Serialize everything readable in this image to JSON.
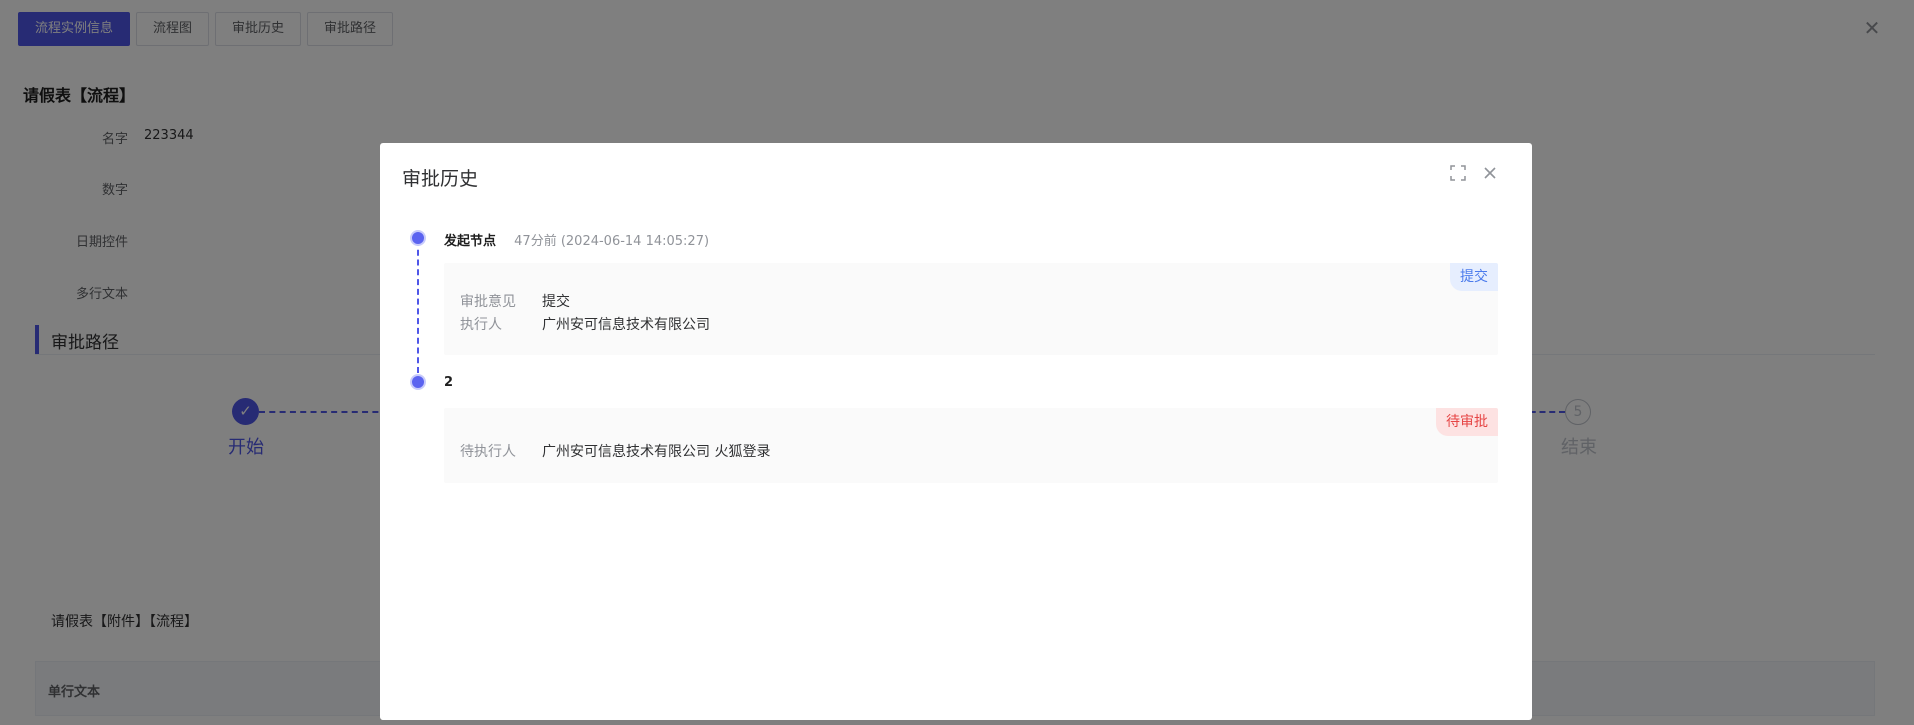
{
  "tabs": [
    {
      "label": "流程实例信息",
      "active": true
    },
    {
      "label": "流程图",
      "active": false
    },
    {
      "label": "审批历史",
      "active": false
    },
    {
      "label": "审批路径",
      "active": false
    }
  ],
  "form": {
    "title": "请假表【流程】",
    "fields": [
      {
        "label": "名字",
        "value": "223344"
      },
      {
        "label": "数字",
        "value": ""
      },
      {
        "label": "日期控件",
        "value": ""
      },
      {
        "label": "多行文本",
        "value": ""
      }
    ]
  },
  "approval_path": {
    "section_title": "审批路径",
    "steps": [
      {
        "label": "开始",
        "status": "done"
      },
      {
        "label": "结束",
        "status": "pending",
        "index": "5"
      }
    ]
  },
  "attachment": {
    "title": "请假表【附件】【流程】",
    "table_header": "单行文本"
  },
  "modal": {
    "title": "审批历史",
    "timeline": [
      {
        "node": "发起节点",
        "time": "47分前  (2024-06-14 14:05:27)",
        "badge": "提交",
        "rows": [
          {
            "key": "审批意见",
            "value": "提交"
          },
          {
            "key": "执行人",
            "value": "广州安可信息技术有限公司"
          }
        ]
      },
      {
        "node": "2",
        "time": "",
        "badge": "待审批",
        "rows": [
          {
            "key": "待执行人",
            "value": "广州安可信息技术有限公司 火狐登录"
          }
        ]
      }
    ]
  },
  "colors": {
    "primary": "#4f56e8",
    "submit_badge": "#4b7bec",
    "pending_badge": "#e64545"
  }
}
